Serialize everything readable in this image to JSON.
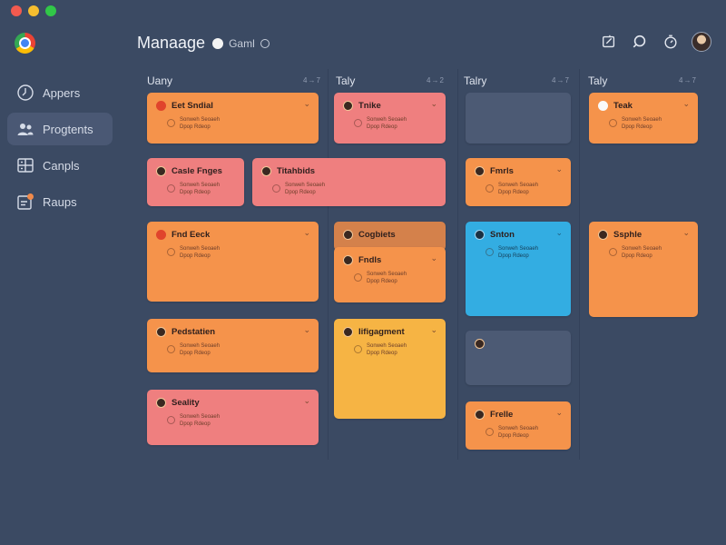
{
  "header": {
    "title": "Manaage",
    "subtitle": "Gaml",
    "icons": [
      "edit-icon",
      "search-icon",
      "timer-icon",
      "user-avatar"
    ]
  },
  "sidebar": {
    "items": [
      {
        "label": "Appers",
        "icon": "clock-icon",
        "active": false
      },
      {
        "label": "Progtents",
        "icon": "people-icon",
        "active": true
      },
      {
        "label": "Canpls",
        "icon": "grid-icon",
        "active": false
      },
      {
        "label": "Raups",
        "icon": "badge-icon",
        "active": false
      }
    ]
  },
  "columns": [
    {
      "title": "Uany",
      "meta": "4→7"
    },
    {
      "title": "Taly",
      "meta": "4→2"
    },
    {
      "title": "Talry",
      "meta": "4→7"
    },
    {
      "title": "Taly",
      "meta": "4→7"
    }
  ],
  "cards": [
    {
      "title": "Eet Sndial",
      "line1": "Sonweh Seoaeh",
      "line2": "Dpop Rdeop",
      "color": "orange",
      "badge": "b-red"
    },
    {
      "title": "Tnike",
      "line1": "Sonweh Seoaeh",
      "line2": "Dpop Rdeop",
      "color": "pink",
      "badge": "b-dark"
    },
    {
      "title": "",
      "line1": "",
      "line2": "",
      "color": "slate",
      "badge": ""
    },
    {
      "title": "Teak",
      "line1": "Sonweh Seoaeh",
      "line2": "Dpop Rdeop",
      "color": "orange",
      "badge": "b-white"
    },
    {
      "title": "Casle Fnges",
      "line1": "Sonweh Seoaeh",
      "line2": "Dpop Rdeop",
      "color": "pink",
      "badge": "b-dark"
    },
    {
      "title": "Titahbids",
      "line1": "Sonweh Seoaeh",
      "line2": "Dpop Rdeop",
      "color": "pink",
      "badge": "b-dark"
    },
    {
      "title": "Fmrls",
      "line1": "Sonweh Seoaeh",
      "line2": "Dpop Rdeop",
      "color": "orange",
      "badge": "b-dark"
    },
    {
      "title": "Fnd Eeck",
      "line1": "Sonweh Seoaeh",
      "line2": "Dpop Rdeop",
      "color": "orange",
      "badge": "b-red"
    },
    {
      "title": "Cogbiets",
      "line1": "",
      "line2": "",
      "color": "brown",
      "badge": "b-dark"
    },
    {
      "title": "Fndls",
      "line1": "Sonweh Seoaeh",
      "line2": "Dpop Rdeop",
      "color": "orange",
      "badge": "b-dark"
    },
    {
      "title": "Snton",
      "line1": "Sonweh Seoaeh",
      "line2": "Dpop Rdeop",
      "color": "blue",
      "badge": "b-blue"
    },
    {
      "title": "Ssphle",
      "line1": "Sonweh Seoaeh",
      "line2": "Dpop Rdeop",
      "color": "orange",
      "badge": "b-dark"
    },
    {
      "title": "Pedstatien",
      "line1": "Sonweh Seoaeh",
      "line2": "Dpop Rdeop",
      "color": "orange",
      "badge": "b-dark"
    },
    {
      "title": "Iifigagment",
      "line1": "Sonweh Seoaeh",
      "line2": "Dpop Rdeop",
      "color": "yellow",
      "badge": "b-dark"
    },
    {
      "title": "",
      "line1": "",
      "line2": "",
      "color": "slate",
      "badge": "b-dark"
    },
    {
      "title": "Seality",
      "line1": "Sonweh Seoaeh",
      "line2": "Dpop Rdeop",
      "color": "pink",
      "badge": "b-dark"
    },
    {
      "title": "Frelle",
      "line1": "Sonweh Seoaeh",
      "line2": "Dpop Rdeop",
      "color": "orange",
      "badge": "b-dark"
    }
  ],
  "colors": {
    "background": "#3b4a63",
    "orange": "#f5934b",
    "pink": "#ef7f7f",
    "yellow": "#f6b444",
    "blue": "#33ade2",
    "slate": "#4c5a74"
  }
}
